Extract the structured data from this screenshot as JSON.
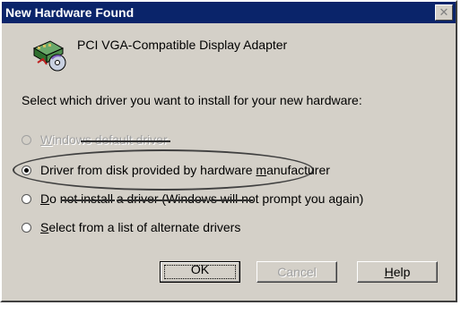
{
  "window": {
    "title": "New Hardware Found",
    "close_glyph": "✕"
  },
  "device": {
    "name": "PCI VGA-Compatible Display Adapter",
    "icon": "hardware-wizard-icon"
  },
  "instruction": "Select which driver you want to install for your new hardware:",
  "options": [
    {
      "pre": "",
      "accel": "W",
      "post": "indows default driver",
      "selected": false,
      "disabled": true
    },
    {
      "pre": "Driver from disk provided by hardware ",
      "accel": "m",
      "post": "anufacturer",
      "selected": true,
      "disabled": false
    },
    {
      "pre": "",
      "accel": "D",
      "post": "o not install a driver (Windows will not prompt you again)",
      "selected": false,
      "disabled": false
    },
    {
      "pre": "",
      "accel": "S",
      "post": "elect from a list of alternate drivers",
      "selected": false,
      "disabled": false
    }
  ],
  "buttons": {
    "ok": "OK",
    "cancel": "Cancel",
    "help_accel": "H",
    "help_rest": "elp"
  }
}
